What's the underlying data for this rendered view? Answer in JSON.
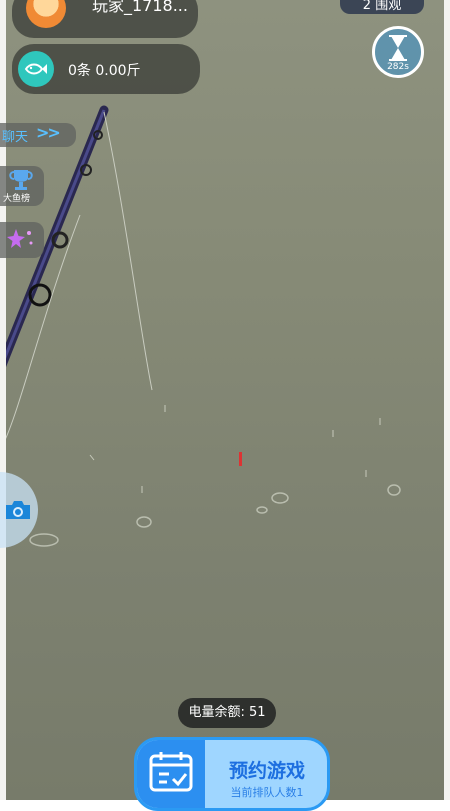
{
  "player": {
    "name": "玩家_1718..."
  },
  "catch": {
    "summary": "0条 0.00斤"
  },
  "viewers": {
    "label": "2 围观"
  },
  "timer": {
    "seconds_label": "282s"
  },
  "sidebar": {
    "chat_label": "聊天",
    "chat_arrows": ">>",
    "rank_label": "大鱼榜"
  },
  "battery": {
    "label": "电量余额: 51"
  },
  "reserve": {
    "title": "预约游戏",
    "queue_label": "当前排队人数1"
  },
  "colors": {
    "water": "#868a76",
    "accent_blue": "#2c8ff0",
    "teal": "#2fc7bd"
  }
}
